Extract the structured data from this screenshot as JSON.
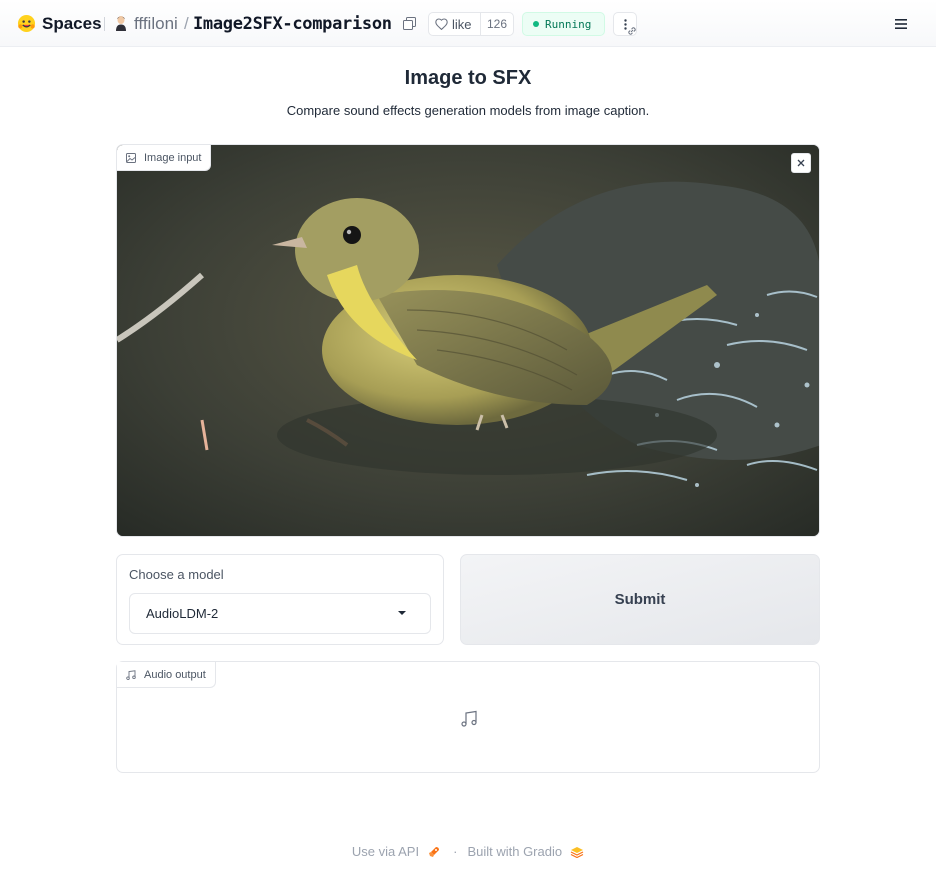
{
  "header": {
    "brand_label": "Spaces",
    "owner": "fffiloni",
    "separator": "/",
    "repo": "Image2SFX-comparison",
    "like_label": "like",
    "like_count": "126",
    "status": "Running",
    "accent_color": "#10b981"
  },
  "main": {
    "title": "Image to SFX",
    "subtitle": "Compare sound effects generation models from image caption.",
    "image_input": {
      "label": "Image input"
    },
    "model_select": {
      "label": "Choose a model",
      "value": "AudioLDM-2"
    },
    "submit_label": "Submit",
    "audio_output": {
      "label": "Audio output"
    }
  },
  "footer": {
    "api_label": "Use via API",
    "separator": "·",
    "built_label": "Built with Gradio"
  },
  "icons": [
    "hf-logo-icon",
    "copy-icon",
    "heart-icon",
    "more-vertical-icon",
    "link-icon",
    "menu-icon",
    "image-icon",
    "close-icon",
    "music-note-icon",
    "rocket-icon",
    "gradio-logo-icon"
  ]
}
